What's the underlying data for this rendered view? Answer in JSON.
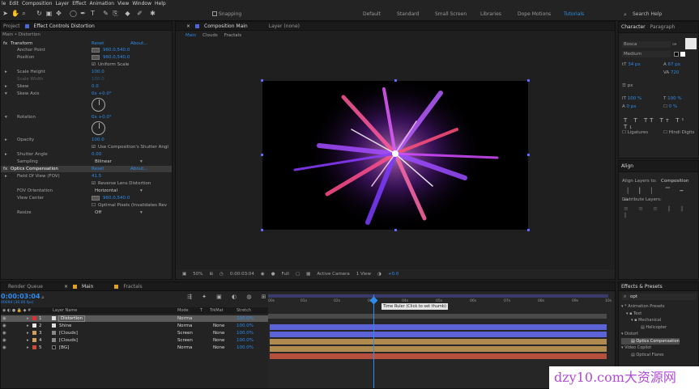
{
  "menu": [
    "le",
    "Edit",
    "Composition",
    "Layer",
    "Effect",
    "Animation",
    "View",
    "Window",
    "Help"
  ],
  "toolbar": {
    "snapping": "Snapping",
    "search_placeholder": "Search Help"
  },
  "workspaces": [
    "Default",
    "Standard",
    "Small Screen",
    "Libraries",
    "Dope Motions",
    "Tutorials"
  ],
  "effect_controls": {
    "tab_project": "Project",
    "tab_effect": "Effect Controls Distortion",
    "subtitle": "Main • Distortion",
    "rows": [
      {
        "label": "Transform",
        "val": "Reset",
        "val2": "About..."
      },
      {
        "label": "Anchor Point",
        "val": "960.0,540.0"
      },
      {
        "label": "Position",
        "val": "960.0,540.0"
      },
      {
        "label": "",
        "val": "Uniform Scale"
      },
      {
        "label": "Scale Height",
        "val": "100.0"
      },
      {
        "label": "Scale Width",
        "val": "100.0"
      },
      {
        "label": "Skew",
        "val": "0.0"
      },
      {
        "label": "Skew Axis",
        "val": "0x +0.0°"
      },
      {
        "label": "Rotation",
        "val": "0x +0.0°"
      },
      {
        "label": "Opacity",
        "val": "100.0"
      },
      {
        "label": "",
        "val": "Use Composition's Shutter Angl"
      },
      {
        "label": "Shutter Angle",
        "val": "0.00"
      },
      {
        "label": "Sampling",
        "val": "Bilinear"
      },
      {
        "label": "Optics Compensation",
        "val": "Reset",
        "val2": "About..."
      },
      {
        "label": "Field Of View (FOV)",
        "val": "41.5"
      },
      {
        "label": "",
        "val": "Reverse Lens Distortion"
      },
      {
        "label": "FOV Orientation",
        "val": "Horizontal"
      },
      {
        "label": "View Center",
        "val": "960.0,540.0"
      },
      {
        "label": "",
        "val": "Optimal Pixels (Invalidates Rev"
      },
      {
        "label": "Resize",
        "val": "Off"
      }
    ]
  },
  "composition": {
    "tab": "Composition Main",
    "layer_tab": "Layer (none)",
    "breadcrumbs": [
      "Main",
      "Clouds",
      "Fractals"
    ],
    "zoom": "50%",
    "time": "0:00:03:04",
    "resolution": "Full",
    "camera": "Active Camera",
    "views": "1 View",
    "exposure": "+0.0"
  },
  "character": {
    "tabs": [
      "Character",
      "Paragraph"
    ],
    "font": "Bosca",
    "style": "Medium",
    "size": "34 px",
    "leading": "67 px",
    "tracking": "720",
    "px": "px",
    "scale_v": "100 %",
    "scale_h": "100 %",
    "baseline": "0 px",
    "tsume": "0 %",
    "ligatures": "Ligatures",
    "hindi": "Hindi Digits"
  },
  "align": {
    "tab": "Align",
    "to_label": "Align Layers to:",
    "to_value": "Composition",
    "distribute": "Distribute Layers:"
  },
  "timeline": {
    "tabs": [
      "Render Queue",
      "Main",
      "Fractals"
    ],
    "timecode": "0:00:03:04",
    "fps": "00094 (30.00 fps)",
    "columns": [
      "Layer Name",
      "Mode",
      "T",
      "TrkMat",
      "Stretch"
    ],
    "layers": [
      {
        "num": "1",
        "name": "Distortion",
        "mode": "Norma",
        "trk": "",
        "stretch": "100.0%",
        "color": "#e03030"
      },
      {
        "num": "2",
        "name": "Shine",
        "mode": "Norma",
        "trk": "None",
        "stretch": "100.0%",
        "color": "#e8e8e8"
      },
      {
        "num": "3",
        "name": "[Clouds]",
        "mode": "Screen",
        "trk": "None",
        "stretch": "100.0%",
        "color": "#c9a060"
      },
      {
        "num": "4",
        "name": "[Clouds]",
        "mode": "Screen",
        "trk": "None",
        "stretch": "100.0%",
        "color": "#c9a060"
      },
      {
        "num": "5",
        "name": "[BG]",
        "mode": "Norma",
        "trk": "None",
        "stretch": "100.0%",
        "color": "#d04a3a"
      }
    ],
    "ruler": [
      "00s",
      "01s",
      "02s",
      "03s",
      "04s",
      "05s",
      "06s",
      "07s",
      "08s",
      "09s",
      "10s"
    ],
    "tooltip": "Time Ruler (Click to set thumb)"
  },
  "effects_presets": {
    "tab": "Effects & Presets",
    "search": "opt",
    "tree": [
      "* Animation Presets",
      "Text",
      "Mechanical",
      "Helicopter",
      "Distort",
      "Optics Compensation",
      "Video Copilot",
      "Optical Flares"
    ]
  },
  "watermark": "dzy10.com大资源网",
  "colors": {
    "accent": "#2d8ceb",
    "bar_blue": "#5b63d6",
    "bar_gold": "#b08a4e",
    "bar_red": "#b5503f"
  }
}
